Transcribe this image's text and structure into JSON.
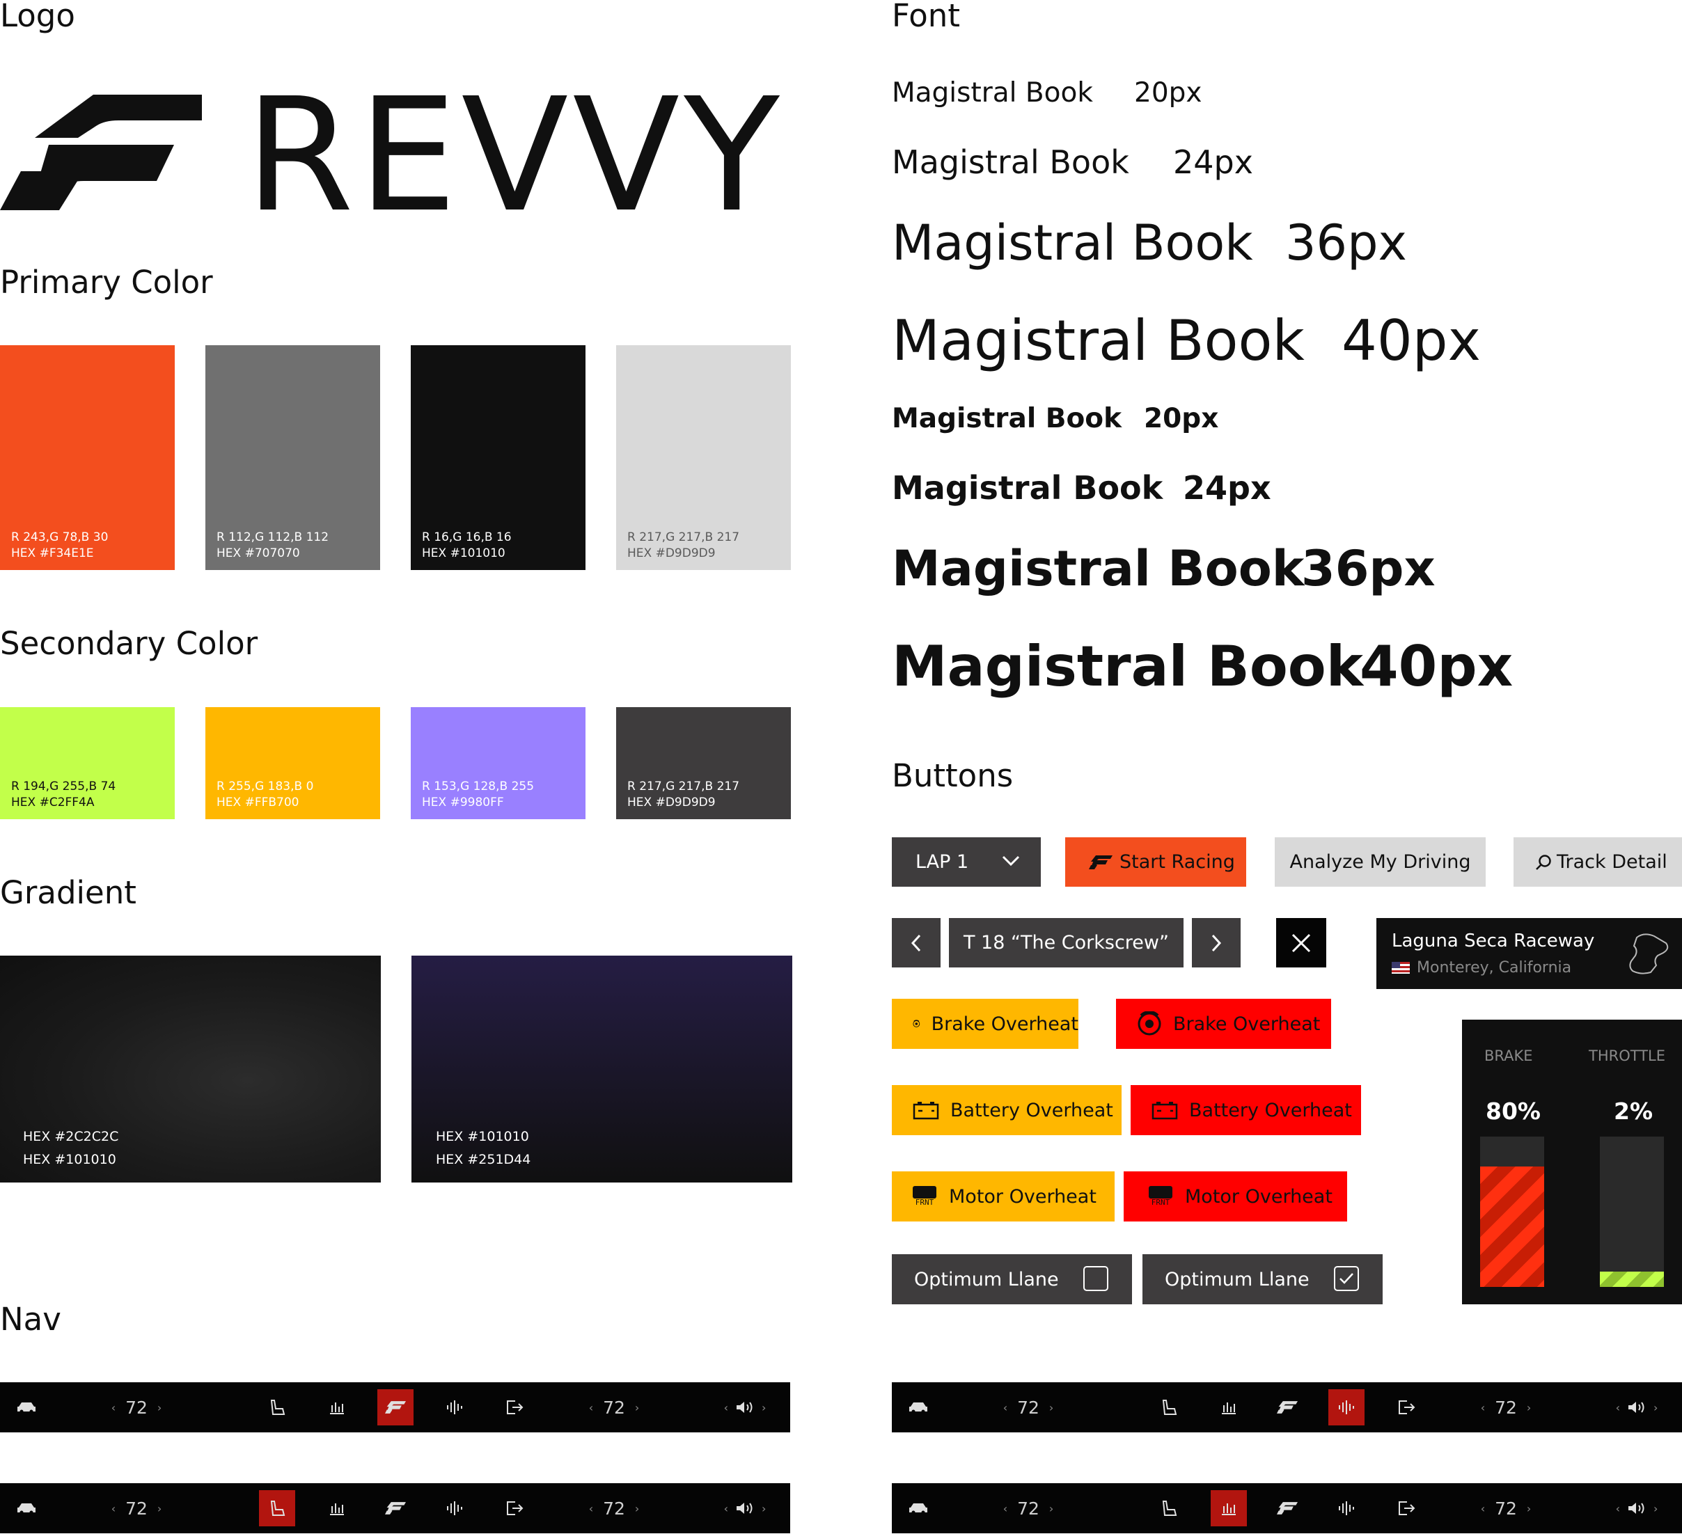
{
  "sections": {
    "logo": "Logo",
    "primary": "Primary Color",
    "secondary": "Secondary Color",
    "gradient": "Gradient",
    "nav": "Nav",
    "font": "Font",
    "buttons": "Buttons"
  },
  "logo": {
    "wordmark": "REVVY",
    "mark_icon": "flag-stripes-icon"
  },
  "primary_colors": [
    {
      "rgb": "R 243,G 78,B 30",
      "hex": "HEX #F34E1E",
      "color": "#F34E1E",
      "text_color": "#ffffff"
    },
    {
      "rgb": "R 112,G 112,B 112",
      "hex": "HEX #707070",
      "color": "#707070",
      "text_color": "#ffffff"
    },
    {
      "rgb": "R 16,G 16,B 16",
      "hex": "HEX #101010",
      "color": "#101010",
      "text_color": "#ffffff"
    },
    {
      "rgb": "R 217,G 217,B 217",
      "hex": "HEX #D9D9D9",
      "color": "#D9D9D9",
      "text_color": "#5a5a5a"
    }
  ],
  "secondary_colors": [
    {
      "rgb": "R 194,G 255,B 74",
      "hex": "HEX #C2FF4A",
      "color": "#C2FF4A",
      "text_color": "#101010"
    },
    {
      "rgb": "R 255,G 183,B 0",
      "hex": "HEX #FFB700",
      "color": "#FFB700",
      "text_color": "#ffffff"
    },
    {
      "rgb": "R 153,G 128,B 255",
      "hex": "HEX #9980FF",
      "color": "#9980FF",
      "text_color": "#ffffff"
    },
    {
      "rgb": "R 217,G 217,B 217",
      "hex": "HEX #D9D9D9",
      "color": "#3E3C3D",
      "text_color": "#ffffff"
    }
  ],
  "gradients": [
    {
      "hex1": "HEX #2C2C2C",
      "hex2": "HEX #101010",
      "from": "#2C2C2C",
      "to": "#101010"
    },
    {
      "hex1": "HEX #101010",
      "hex2": "HEX #251D44",
      "from": "#251D44",
      "to": "#101010"
    }
  ],
  "font_samples": [
    {
      "name": "Magistral Book",
      "size": "20px"
    },
    {
      "name": "Magistral Book",
      "size": "24px"
    },
    {
      "name": "Magistral Book",
      "size": "36px"
    },
    {
      "name": "Magistral Book",
      "size": "40px"
    },
    {
      "name": "Magistral Book",
      "size": "20px"
    },
    {
      "name": "Magistral Book",
      "size": "24px"
    },
    {
      "name": "Magistral Book",
      "size": "36px"
    },
    {
      "name": "Magistral Book",
      "size": "40px"
    }
  ],
  "buttons": {
    "lap": "LAP 1",
    "start_racing": "Start Racing",
    "analyze": "Analyze My Driving",
    "track_detail": "Track Detail",
    "corner": "T 18 “The Corkscrew”",
    "track_name": "Laguna Seca Raceway",
    "track_location": "Monterey, California",
    "brake_overheat": "Brake Overheat",
    "battery_overheat": "Battery Overheat",
    "motor_overheat": "Motor Overheat",
    "optimum": "Optimum Llane",
    "motor_icon_text": "FRNT"
  },
  "gauges": {
    "brake_label": "BRAKE",
    "brake_value": "80%",
    "brake_level": 0.8,
    "throttle_label": "THROTTLE",
    "throttle_value": "2%",
    "throttle_level": 0.02
  },
  "colors": {
    "orange": "#F34E1E",
    "dark": "#101010",
    "yellow": "#FFB700",
    "red": "#FF0000",
    "lime": "#C2FF4A",
    "nav_active": "#B2150F"
  },
  "nav_bars": [
    {
      "left_value": "72",
      "right_value": "72",
      "active": "logo"
    },
    {
      "left_value": "72",
      "right_value": "72",
      "active": "seat"
    },
    {
      "left_value": "72",
      "right_value": "72",
      "active": "sound"
    },
    {
      "left_value": "72",
      "right_value": "72",
      "active": "chart"
    }
  ]
}
